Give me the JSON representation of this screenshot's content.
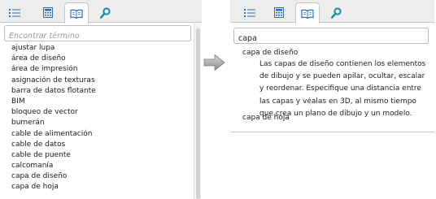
{
  "icons": {
    "list": "list-icon",
    "calculator": "calculator-icon",
    "book": "open-book-icon",
    "search": "magnifier-icon",
    "arrow": "arrow-right-icon"
  },
  "colors": {
    "tab_bar": "#ededed",
    "icon_blue": "#2b6fb6",
    "magnifier_teal": "#1f8aa3"
  },
  "left_panel": {
    "search_placeholder": "Encontrar término",
    "terms": [
      "ajustar lupa",
      "área de diseño",
      "área de impresión",
      "asignación de texturas",
      "barra de datos flotante",
      "BIM",
      "bloqueo de vector",
      "bumerán",
      "cable de alimentación",
      "cable de datos",
      "cable de puente",
      "calcomanía",
      "capa de diseño",
      "capa de hoja"
    ]
  },
  "right_panel": {
    "search_value": "capa",
    "results": [
      {
        "term": "capa de diseño",
        "description": "Las capas de diseño contienen los elementos de dibujo y se pueden apilar, ocultar, escalar y reordenar. Especifique una distancia entre las capas y véalas en 3D, al mismo tiempo que crea un plano de dibujo y un modelo."
      },
      {
        "term": "capa de hoja",
        "description": ""
      }
    ]
  }
}
